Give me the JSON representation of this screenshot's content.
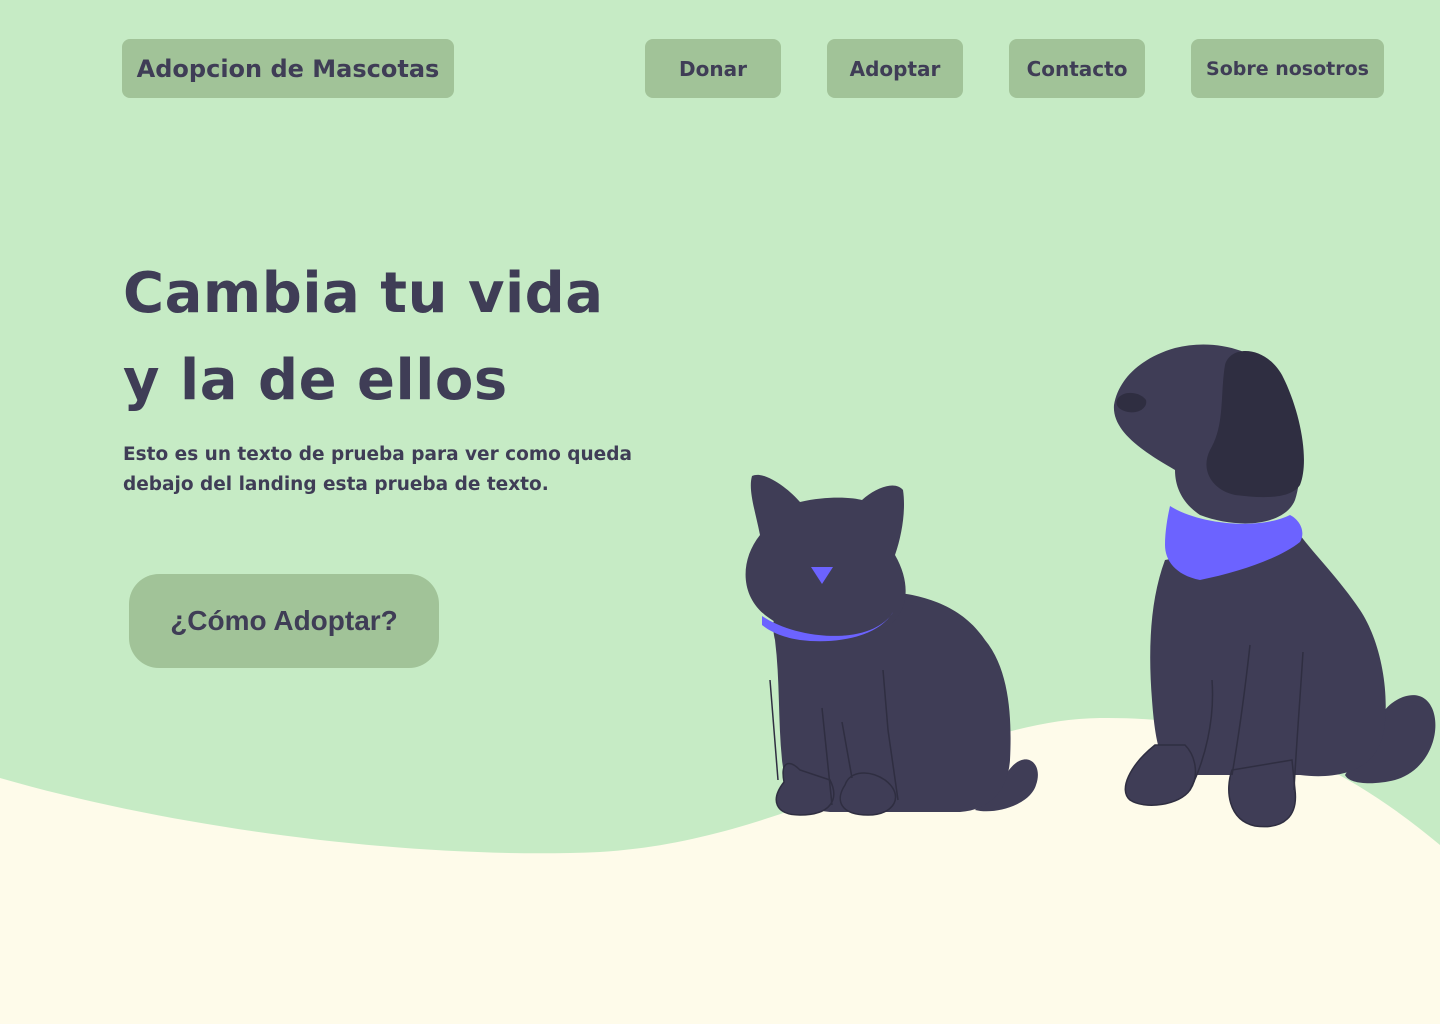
{
  "header": {
    "brand": "Adopcion de Mascotas",
    "nav": {
      "donar": "Donar",
      "adoptar": "Adoptar",
      "contacto": "Contacto",
      "sobre": "Sobre nosotros"
    }
  },
  "hero": {
    "title_line1": "Cambia tu vida",
    "title_line2": "y la de ellos",
    "text": "Esto es un texto de prueba para ver como queda debajo del landing esta prueba de texto.",
    "cta_label": "¿Cómo Adoptar?"
  },
  "colors": {
    "background": "#c6ebc5",
    "ground": "#fefbea",
    "pill": "#a1c398",
    "text": "#3f3d56",
    "pet_body": "#3f3d56",
    "pet_ear": "#2f2e41",
    "accent": "#6c63ff"
  },
  "icons": {
    "cat": "cat-illustration",
    "dog": "dog-illustration"
  }
}
